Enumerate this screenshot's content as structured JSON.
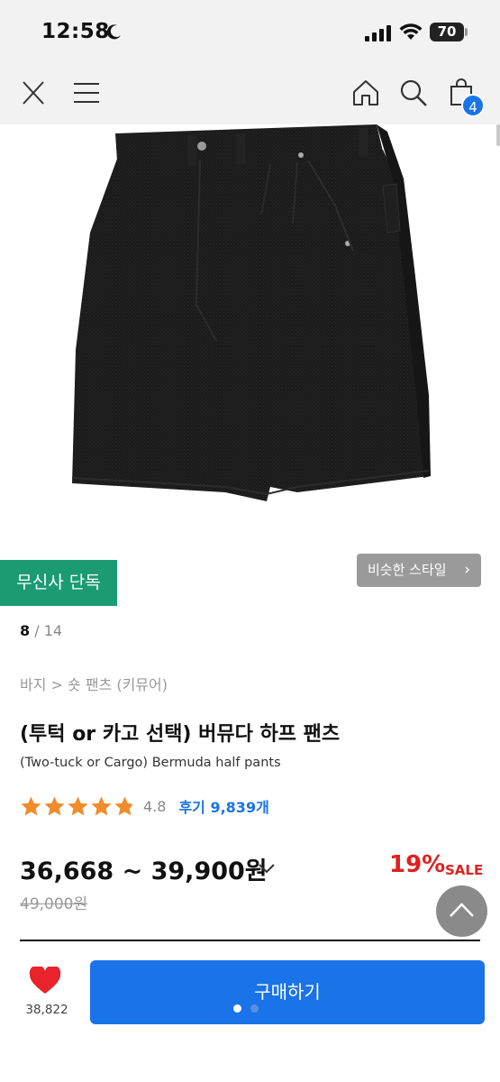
{
  "status_bar": {
    "time": "12:58",
    "battery": "70"
  },
  "nav": {
    "close_icon": "close-icon",
    "menu_icon": "hamburger-menu-icon",
    "home_icon": "home-icon",
    "search_icon": "search-icon",
    "cart_icon": "shopping-bag-icon",
    "cart_count": "4"
  },
  "gallery": {
    "exclusive_badge": "무신사 단독",
    "similar_style": "비슷한 스타일",
    "current_page": "8",
    "page_separator": " / ",
    "total_pages": "14"
  },
  "product": {
    "breadcrumb": "바지 > 숏 팬츠 (키뮤어)",
    "title": "(투턱 or 카고 선택) 버뮤다 하프 팬츠",
    "subtitle": "(Two-tuck or Cargo) Bermuda half pants",
    "rating_value": "4.8",
    "rating_fraction": 0.96,
    "review_label": "후기 9,839개",
    "price_range": "36,668 ~ 39,900원",
    "discount": "19%",
    "sale_label": "SALE",
    "original_price": "49,000원"
  },
  "bottom_bar": {
    "like_count": "38,822",
    "buy_label": "구매하기"
  },
  "colors": {
    "accent_blue": "#1a73e8",
    "exclusive_green": "#1b9b73",
    "sale_red": "#e02020",
    "star_orange": "#f08c2a",
    "heart_red": "#e8232b"
  }
}
